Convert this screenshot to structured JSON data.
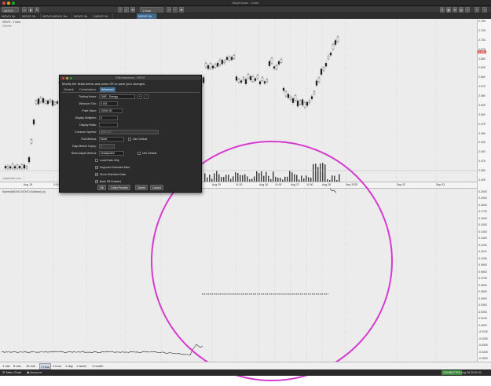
{
  "window": {
    "title": "NinjaTrader - Chart"
  },
  "toolbar": {
    "instrument": "NOVO",
    "interval": "1 hour",
    "items": [
      "NOVO 1h",
      "NOVO-NOVO 1hr",
      "NOVO 1h",
      "NOVO 1h"
    ]
  },
  "tabs": [
    {
      "label": "NOVO 1h",
      "active": false
    },
    {
      "label": "NOVO 1h",
      "active": false
    },
    {
      "label": "NOVO-NOVO 1hr",
      "active": false
    },
    {
      "label": "NOVO 1h",
      "active": false
    },
    {
      "label": "NOVO 1h",
      "active": false
    },
    {
      "label": "NOVO 1h",
      "active": true
    }
  ],
  "top_chart": {
    "label": "NOVO - 1 hour",
    "sublabel": "Volume",
    "y_ticks": [
      "2.750",
      "2.725",
      "2.700",
      "2.675",
      "2.650",
      "2.625",
      "2.600",
      "2.575",
      "2.550",
      "2.525",
      "2.500",
      "2.475",
      "2.450",
      "2.425",
      "2.400",
      "2.375",
      "2.350",
      "2.325"
    ],
    "price_badge": "2.632",
    "watermark": "ninjatrader.com"
  },
  "time_axis": {
    "ticks": [
      "Aug 18",
      "3:00",
      "Aug 20",
      "Aug 22",
      "3:00",
      "Aug 25",
      "11:00",
      "Aug 26",
      "11:00",
      "Aug 27",
      "11:00",
      "Aug 28",
      "Sep 2025",
      "Sep 02",
      "Sep 03"
    ]
  },
  "bottom_chart": {
    "label": "Symbol(NOVO-NOVO,Subtract) (n)",
    "y_ticks": [
      "0.2000",
      "0.1900",
      "0.1800",
      "0.1700",
      "0.1600",
      "0.1500",
      "0.1400",
      "0.1300",
      "0.1200",
      "0.1100",
      "0.1000",
      "0.0900",
      "0.0800",
      "0.0700",
      "0.0600",
      "0.0500",
      "0.0400",
      "0.0300",
      "0.0200",
      "0.0100",
      "0.0000",
      "-0.0100",
      "-0.0200",
      "-0.0300",
      "-0.0400",
      "-0.0500"
    ]
  },
  "dialog": {
    "title": "Edit Instrument - NOVO",
    "intro": "Modify the fields below and press OK to save your changes.",
    "tabs": [
      "General",
      "Commissions",
      "Advanced"
    ],
    "active_tab": "Advanced",
    "fields": {
      "trading_hours": {
        "label": "Trading Hours:",
        "value": "CME - Energy"
      },
      "min_tick": {
        "label": "Minimum Tick:",
        "value": "0.001"
      },
      "point_value": {
        "label": "Point Value:",
        "value": "10000.00"
      },
      "display_multiplier": {
        "label": "Display Multiplier:",
        "value": "0"
      },
      "display_mask": {
        "label": "Display Mask:",
        "value": ""
      },
      "common_symbol": {
        "label": "Common Symbol:",
        "value": "@NOVO"
      },
      "roll_method": {
        "label": "Roll Method:",
        "value": "None"
      },
      "days_before_expiry": {
        "label": "Days Before Expiry:",
        "value": "0"
      },
      "back_adjust": {
        "label": "Back Adjust Method:",
        "value": "Unadjusted"
      }
    },
    "checks": {
      "use_default_roll": {
        "label": "Use Default",
        "checked": false
      },
      "use_default_adjust": {
        "label": "Use Default",
        "checked": false
      },
      "local_data_only": {
        "label": "Local Data Only",
        "checked": false
      },
      "supports_extended": {
        "label": "Supports Extended Data",
        "checked": true
      },
      "show_extended": {
        "label": "Show Extended Data",
        "checked": true
      },
      "back_fill": {
        "label": "Back Fill Enabled",
        "checked": true
      }
    },
    "buttons": {
      "ok": "OK",
      "order_presets": "Order Presets",
      "delete": "Delete",
      "cancel": "Cancel"
    }
  },
  "timeframes": [
    "1 min",
    "5 min",
    "15 min",
    "1 hour",
    "4 hour",
    "1 day",
    "1 week",
    "1 month"
  ],
  "active_timeframe": "1 hour",
  "status": {
    "left": "Main Chart",
    "account": "Account",
    "connection": "CONNECTED",
    "clock": "Aug 28 20:31:34"
  },
  "colors": {
    "annotation_circle": "#d63bd0",
    "accent": "#3f6a8f"
  }
}
